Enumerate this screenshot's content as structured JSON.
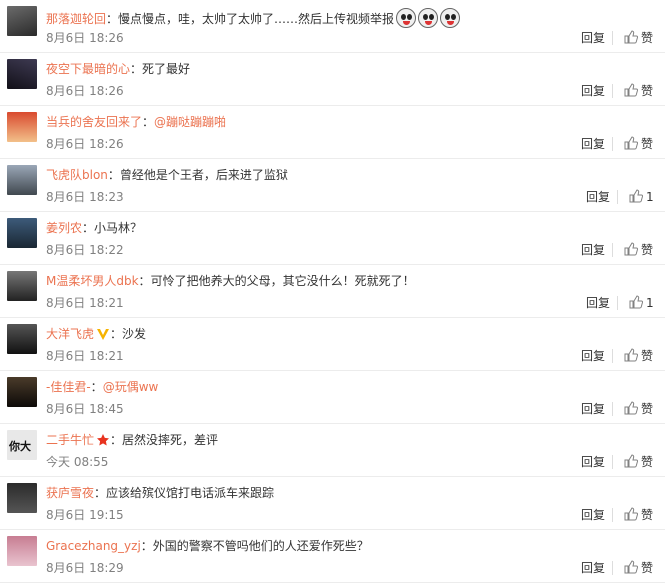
{
  "comments": [
    {
      "user": "那落迦轮回",
      "text": "慢点慢点，哇，太帅了太帅了……然后上传视频举报",
      "time": "8月6日 18:26",
      "reply": "回复",
      "like": "赞",
      "emoticons": 3,
      "avatar": "rail-avatar"
    },
    {
      "user": "夜空下最暗的心",
      "text": "死了最好",
      "time": "8月6日 18:26",
      "reply": "回复",
      "like": "赞",
      "avatar": "night-avatar"
    },
    {
      "user": "当兵的舍友回来了",
      "text": "",
      "mention": "@蹦哒蹦蹦啪",
      "time": "8月6日 18:26",
      "reply": "回复",
      "like": "赞",
      "avatar": "anime-avatar"
    },
    {
      "user": "飞虎队blon",
      "text": "曾经他是个王者，后来进了监狱",
      "time": "8月6日 18:23",
      "reply": "回复",
      "like": "1",
      "avatar": "car-avatar"
    },
    {
      "user": "姜列农",
      "text": "小马林？",
      "time": "8月6日 18:22",
      "reply": "回复",
      "like": "赞",
      "avatar": "blue-avatar"
    },
    {
      "user": "M温柔坏男人dbk",
      "text": "可怜了把他养大的父母，其它没什么！死就死了！",
      "time": "8月6日 18:21",
      "reply": "回复",
      "like": "1",
      "avatar": "road-avatar"
    },
    {
      "user": "大洋飞虎",
      "text": "沙发",
      "time": "8月6日 18:21",
      "reply": "回复",
      "like": "赞",
      "badge": "vip-v-icon",
      "avatar": "face-avatar"
    },
    {
      "user": "-佳佳君-",
      "text": "",
      "mention": "@玩偶ww",
      "time": "8月6日 18:45",
      "reply": "回复",
      "like": "赞",
      "avatar": "girl-avatar"
    },
    {
      "user": "二手牛忙",
      "text": "居然没摔死，差评",
      "time": "今天 08:55",
      "reply": "回复",
      "like": "赞",
      "badge": "star-icon",
      "avatar": "calligraphy-avatar"
    },
    {
      "user": "获庐雪夜",
      "text": "应该给殡仪馆打电话派车来跟踪",
      "time": "8月6日 19:15",
      "reply": "回复",
      "like": "赞",
      "avatar": "dark-avatar"
    },
    {
      "user": "Gracezhang_yzj",
      "text": "外国的警察不管吗他们的人还爱作死些？",
      "time": "8月6日 18:29",
      "reply": "回复",
      "like": "赞",
      "avatar": "pink-avatar"
    }
  ],
  "colors": {
    "username": "#eb7350",
    "time": "#808080",
    "divider": "#ececec"
  }
}
